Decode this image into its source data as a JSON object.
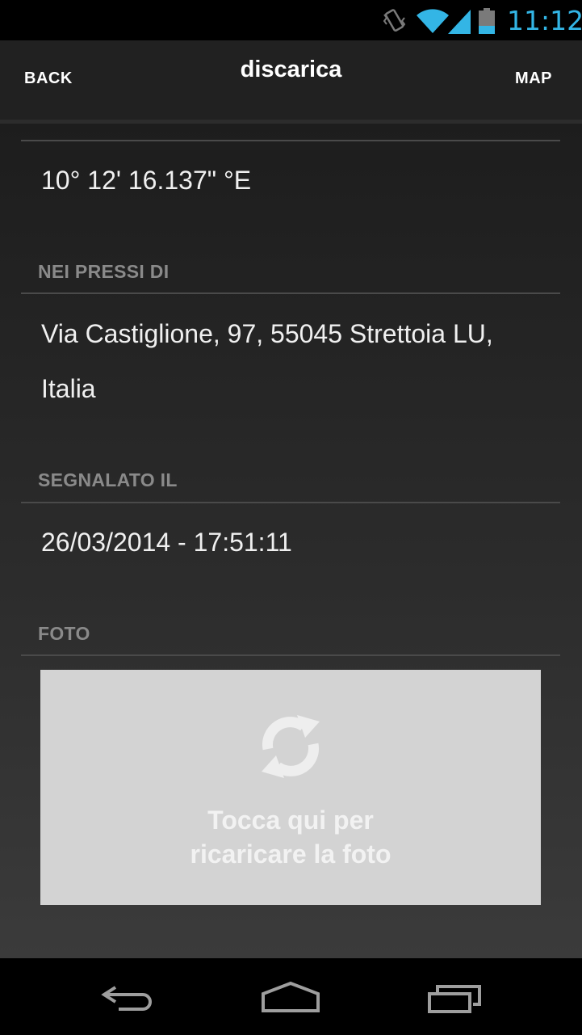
{
  "status_bar": {
    "time": "11:12",
    "icons": [
      "vibrate-icon",
      "wifi-icon",
      "signal-icon",
      "battery-icon"
    ],
    "accent_color": "#33b5e5"
  },
  "action_bar": {
    "back_label": "BACK",
    "title": "discarica",
    "map_label": "MAP"
  },
  "details": {
    "longitude": "10° 12' 16.137\" °E",
    "nearby_header": "NEI PRESSI DI",
    "address_line1": "Via Castiglione, 97, 55045 Strettoia LU,",
    "address_line2": "Italia",
    "reported_header": "SEGNALATO IL",
    "reported_at": "26/03/2014 - 17:51:11",
    "photo_header": "FOTO"
  },
  "photo": {
    "icon": "refresh-icon",
    "line1": "Tocca qui per",
    "line2": "ricaricare la foto"
  },
  "nav_bar": {
    "icons": [
      "back-icon",
      "home-icon",
      "recents-icon"
    ]
  }
}
